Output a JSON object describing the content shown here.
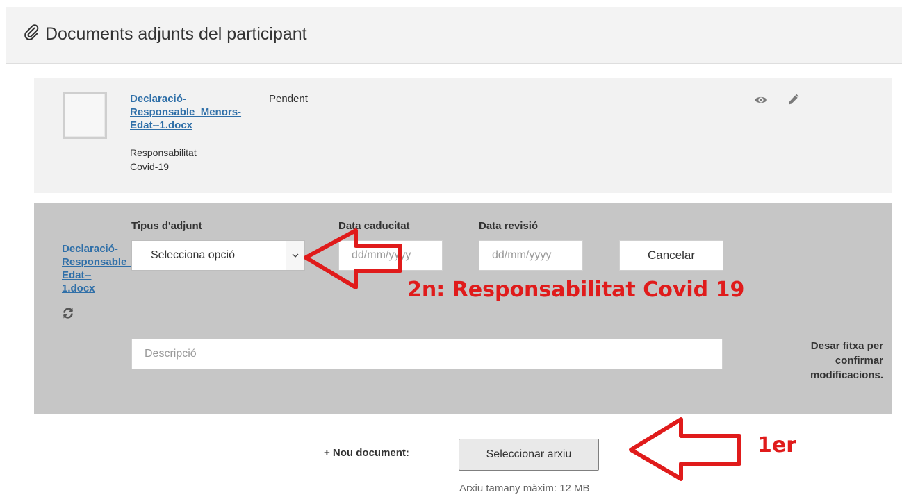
{
  "panel": {
    "title": "Documents adjunts del participant",
    "title_icon": "paperclip-icon"
  },
  "document": {
    "filename_lines": [
      "Declaració-",
      "Responsable_Menors-",
      "Edat--1.docx"
    ],
    "type_lines": [
      "Responsabilitat",
      "Covid-19"
    ],
    "status": "Pendent",
    "actions": [
      "eye-icon",
      "pencil-icon"
    ]
  },
  "edit_form": {
    "type_label": "Tipus d'adjunt",
    "type_value": "Selecciona opció",
    "expiry_label": "Data caducitat",
    "expiry_placeholder": "dd/mm/yyyy",
    "review_label": "Data revisió",
    "review_placeholder": "dd/mm/yyyy",
    "cancel_label": "Cancelar",
    "side_filename_lines": [
      "Declaració-",
      "Responsable_",
      "Edat--",
      "1.docx"
    ],
    "refresh_icon": "refresh-icon",
    "description_placeholder": "Descripció",
    "save_hint_lines": [
      "Desar fitxa per",
      "confirmar",
      "modificacions."
    ]
  },
  "upload": {
    "new_doc_label": "+ Nou document:",
    "select_file_label": "Seleccionar arxiu",
    "max_size_text": "Arxiu tamany màxim: 12 MB"
  },
  "annotations": {
    "step2": "2n: Responsabilitat Covid 19",
    "step1": "1er",
    "color": "#e01b1b"
  },
  "colors": {
    "link": "#2f6fa8",
    "header_bg": "#f3f3f3",
    "card_bg": "#f2f2f2",
    "edit_bg": "#c6c6c6"
  }
}
